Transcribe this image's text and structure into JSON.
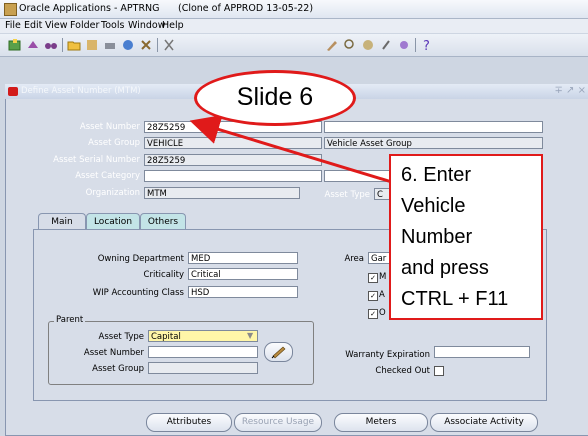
{
  "window": {
    "title": "Oracle Applications - APTRNG",
    "subtitle": "(Clone of APPROD 13-05-22)"
  },
  "menu": [
    "File",
    "Edit",
    "View",
    "Folder",
    "Tools",
    "Window",
    "Help"
  ],
  "toolbar_icons": [
    "new-icon",
    "find-icon",
    "binoculars-icon",
    "folder-icon",
    "save-icon",
    "print-icon",
    "close-icon",
    "help-icon"
  ],
  "form": {
    "title": "Define Asset Number (MTM)",
    "controls": "∓ ↗ ×"
  },
  "header_fields": {
    "asset_number": {
      "label": "Asset Number",
      "value": "28Z5259"
    },
    "asset_group": {
      "label": "Asset Group",
      "value": "VEHICLE",
      "description": "Vehicle Asset Group"
    },
    "asset_serial_number": {
      "label": "Asset Serial Number",
      "value": "28Z5259"
    },
    "asset_category": {
      "label": "Asset Category",
      "value": ""
    },
    "organization": {
      "label": "Organization",
      "value": "MTM"
    },
    "asset_type": {
      "label": "Asset Type",
      "value": "C"
    }
  },
  "tabs": [
    "Main",
    "Location",
    "Others"
  ],
  "main_tab": {
    "owning_department": {
      "label": "Owning Department",
      "value": "MED"
    },
    "criticality": {
      "label": "Criticality",
      "value": "Critical"
    },
    "wip_accounting_class": {
      "label": "WIP Accounting Class",
      "value": "HSD"
    },
    "area": {
      "label": "Area",
      "value": "Gar"
    },
    "checkboxes": [
      {
        "label": "M",
        "checked": true
      },
      {
        "label": "A",
        "checked": true
      },
      {
        "label": "O",
        "checked": true
      }
    ],
    "parent": {
      "title": "Parent",
      "asset_type": {
        "label": "Asset Type",
        "value": "Capital"
      },
      "asset_number": {
        "label": "Asset  Number",
        "value": ""
      },
      "asset_group": {
        "label": "Asset Group",
        "value": ""
      }
    },
    "warranty_expiration": {
      "label": "Warranty Expiration",
      "value": ""
    },
    "checked_out": {
      "label": "Checked Out",
      "checked": false
    }
  },
  "buttons": {
    "attributes": "Attributes",
    "resource_usage": "Resource Usage",
    "meters": "Meters",
    "associate_activity": "Associate Activity"
  },
  "overlay": {
    "slide_label": "Slide 6",
    "instruction": "6. Enter\nVehicle\nNumber\nand press\nCTRL + F11"
  },
  "colors": {
    "annotation_red": "#e01a1a",
    "inactive_tab": "#c3e4e7",
    "required_field": "#fff6a8"
  }
}
